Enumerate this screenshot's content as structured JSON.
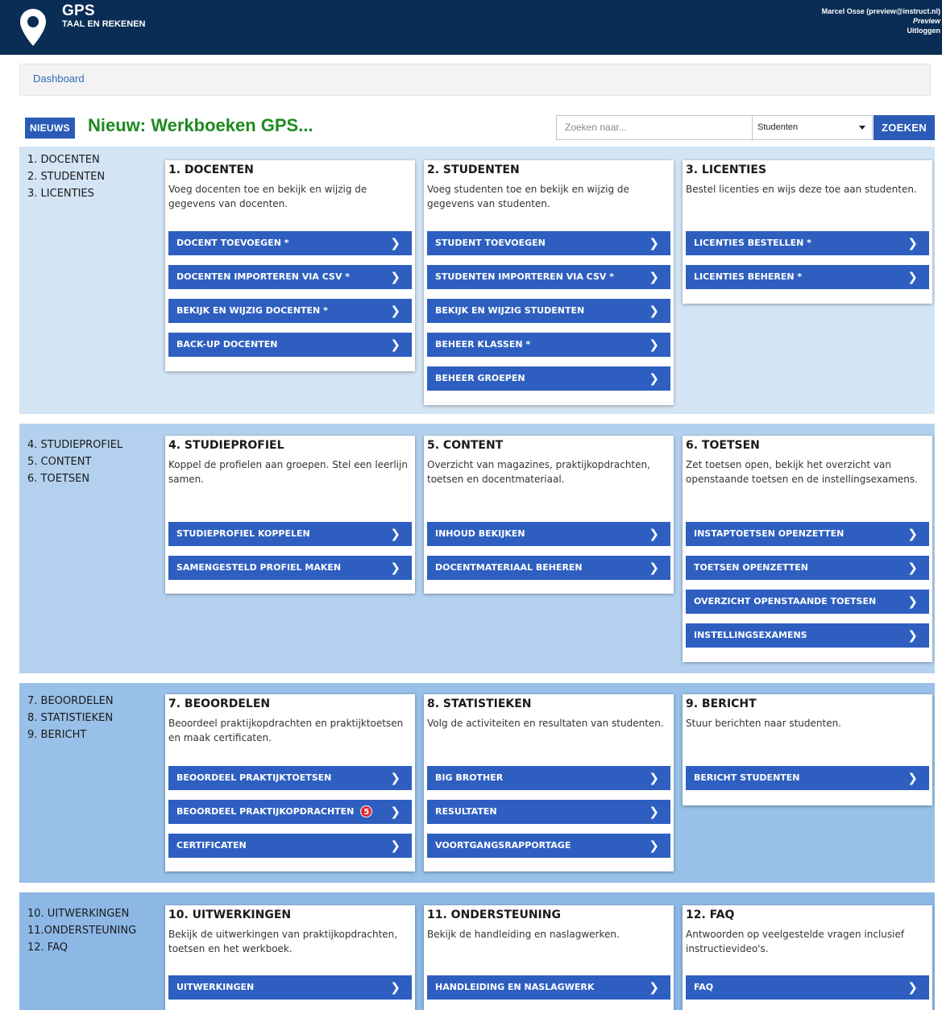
{
  "header": {
    "title": "GPS",
    "subtitle": "TAAL EN REKENEN",
    "user": "Marcel Osse (preview@instruct.nl)",
    "mode": "Preview",
    "logout": "Uitloggen"
  },
  "breadcrumb": {
    "dashboard": "Dashboard"
  },
  "news": {
    "badge": "NIEUWS",
    "title": "Nieuw: Werkboeken GPS..."
  },
  "search": {
    "placeholder": "Zoeken naar...",
    "select_value": "Studenten",
    "button": "ZOEKEN"
  },
  "colors": {
    "header_bg": "#0a2d55",
    "accent": "#2a5bb7",
    "news_green": "#1d8a1d",
    "section_1": "#d3e4f4",
    "section_2": "#b3d1ee",
    "section_3": "#98c0e8",
    "section_4": "#8db8e6"
  },
  "sections": [
    {
      "list": [
        "1. DOCENTEN",
        "2. STUDENTEN",
        "3. LICENTIES"
      ],
      "cards": [
        {
          "title": "1. DOCENTEN",
          "desc": "Voeg docenten toe en bekijk en wijzig de gegevens van docenten.",
          "buttons": [
            "DOCENT TOEVOEGEN *",
            "DOCENTEN IMPORTEREN VIA CSV *",
            "BEKIJK EN WIJZIG DOCENTEN *",
            "BACK-UP DOCENTEN"
          ]
        },
        {
          "title": "2. STUDENTEN",
          "desc": "Voeg studenten toe en bekijk en wijzig de gegevens van studenten.",
          "buttons": [
            "STUDENT TOEVOEGEN",
            "STUDENTEN IMPORTEREN VIA CSV *",
            "BEKIJK EN WIJZIG STUDENTEN",
            "BEHEER KLASSEN *",
            "BEHEER GROEPEN"
          ]
        },
        {
          "title": "3. LICENTIES",
          "desc": "Bestel licenties en wijs deze toe aan studenten.",
          "buttons": [
            "LICENTIES BESTELLEN *",
            "LICENTIES BEHEREN *"
          ]
        }
      ]
    },
    {
      "list": [
        "4. STUDIEPROFIEL",
        "5. CONTENT",
        "6. TOETSEN"
      ],
      "cards": [
        {
          "title": "4. STUDIEPROFIEL",
          "desc": "Koppel de profielen aan groepen. Stel een leerlijn samen.",
          "buttons": [
            "STUDIEPROFIEL KOPPELEN",
            "SAMENGESTELD PROFIEL MAKEN"
          ]
        },
        {
          "title": "5. CONTENT",
          "desc": "Overzicht van magazines, praktijkopdrachten, toetsen en docentmateriaal.",
          "buttons": [
            "INHOUD BEKIJKEN",
            "DOCENTMATERIAAL BEHEREN"
          ]
        },
        {
          "title": "6. TOETSEN",
          "desc": "Zet toetsen open, bekijk het overzicht van openstaande toetsen en de instellingsexamens.",
          "buttons": [
            "INSTAPTOETSEN OPENZETTEN",
            "TOETSEN OPENZETTEN",
            "OVERZICHT OPENSTAANDE TOETSEN",
            "INSTELLINGSEXAMENS"
          ]
        }
      ]
    },
    {
      "list": [
        "7. BEOORDELEN",
        "8. STATISTIEKEN",
        "9. BERICHT"
      ],
      "cards": [
        {
          "title": "7. BEOORDELEN",
          "desc": "Beoordeel praktijkopdrachten en praktijktoetsen en maak certificaten.",
          "buttons": [
            "BEOORDEEL PRAKTIJKTOETSEN",
            "BEOORDEEL PRAKTIJKOPDRACHTEN",
            "CERTIFICATEN"
          ],
          "badge_count": "5"
        },
        {
          "title": "8. STATISTIEKEN",
          "desc": "Volg de activiteiten en resultaten van studenten.",
          "buttons": [
            "BIG BROTHER",
            "RESULTATEN",
            "VOORTGANGSRAPPORTAGE"
          ]
        },
        {
          "title": "9. BERICHT",
          "desc": "Stuur berichten naar studenten.",
          "buttons": [
            "BERICHT STUDENTEN"
          ]
        }
      ]
    },
    {
      "list": [
        "10. UITWERKINGEN",
        "11.ONDERSTEUNING",
        "12. FAQ"
      ],
      "cards": [
        {
          "title": "10. UITWERKINGEN",
          "desc": "Bekijk de uitwerkingen van praktijkopdrachten, toetsen en het werkboek.",
          "buttons": [
            "UITWERKINGEN"
          ]
        },
        {
          "title": "11. ONDERSTEUNING",
          "desc": "Bekijk de handleiding en naslagwerken.",
          "buttons": [
            "HANDLEIDING EN NASLAGWERK"
          ]
        },
        {
          "title": "12. FAQ",
          "desc": "Antwoorden op veelgestelde vragen inclusief instructievideo's.",
          "buttons": [
            "FAQ"
          ]
        }
      ]
    }
  ]
}
